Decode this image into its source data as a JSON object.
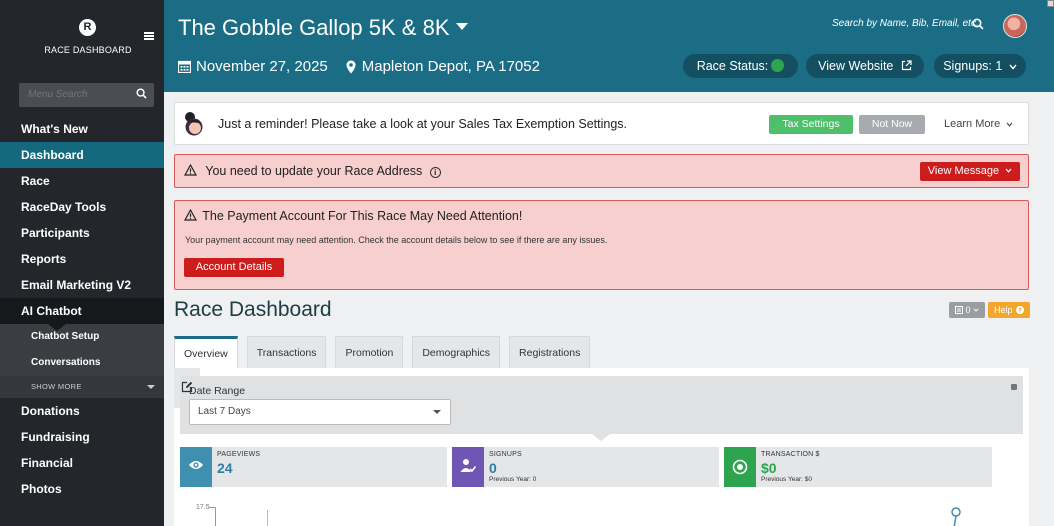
{
  "sidebar": {
    "brand": "RACE DASHBOARD",
    "logo_letter": "R",
    "search_placeholder": "Menu Search",
    "items": [
      {
        "label": "What's New"
      },
      {
        "label": "Dashboard",
        "state": "active"
      },
      {
        "label": "Race"
      },
      {
        "label": "RaceDay Tools"
      },
      {
        "label": "Participants"
      },
      {
        "label": "Reports"
      },
      {
        "label": "Email Marketing V2"
      },
      {
        "label": "AI Chatbot",
        "state": "open"
      }
    ],
    "subitems": [
      {
        "label": "Chatbot Setup"
      },
      {
        "label": "Conversations"
      }
    ],
    "show_more": "SHOW MORE",
    "items_after": [
      {
        "label": "Donations"
      },
      {
        "label": "Fundraising"
      },
      {
        "label": "Financial"
      },
      {
        "label": "Photos"
      }
    ]
  },
  "header": {
    "race_title": "The Gobble Gallop 5K & 8K",
    "date": "November 27, 2025",
    "location": "Mapleton Depot, PA 17052",
    "search_placeholder": "Search by Name, Bib, Email, etc.",
    "race_status_label": "Race Status:",
    "view_website_label": "View Website",
    "signups_label": "Signups: 1"
  },
  "reminder": {
    "message": "Just a reminder! Please take a look at your Sales Tax Exemption Settings.",
    "tax_button": "Tax Settings",
    "not_now_button": "Not Now",
    "learn_more": "Learn More"
  },
  "alert_address": {
    "message": "You need to update your Race Address",
    "button": "View Message"
  },
  "alert_payment": {
    "title": "The Payment Account For This Race May Need Attention!",
    "body": "Your payment account may need attention. Check the account details below to see if there are any issues.",
    "button": "Account Details"
  },
  "dashboard": {
    "title": "Race Dashboard",
    "count_button": "0",
    "help_button": "Help",
    "tabs": [
      {
        "label": "Overview",
        "active": true
      },
      {
        "label": "Transactions"
      },
      {
        "label": "Promotion"
      },
      {
        "label": "Demographics"
      },
      {
        "label": "Registrations"
      }
    ],
    "date_range_label": "Date Range",
    "date_range_value": "Last 7 Days",
    "cards": [
      {
        "label": "PAGEVIEWS",
        "value": "24",
        "prev": ""
      },
      {
        "label": "SIGNUPS",
        "value": "0",
        "prev": "Previous Year: 0"
      },
      {
        "label": "TRANSACTION $",
        "value": "$0",
        "prev": "Previous Year: $0"
      }
    ],
    "chart_tick": "17.5"
  },
  "colors": {
    "header_bg": "#1b6d86",
    "sidebar_bg": "#23272b",
    "active_nav": "#15697e",
    "alert_red": "#cc1c1c",
    "green": "#2ea44f",
    "purple": "#6f56b5",
    "orange": "#f4a62a"
  }
}
